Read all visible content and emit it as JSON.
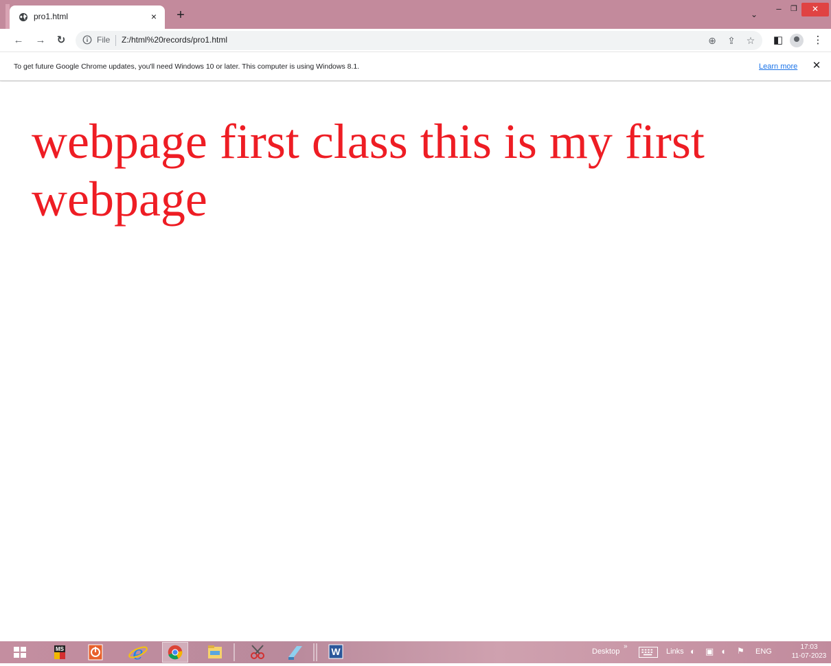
{
  "browser": {
    "tab_title": "pro1.html",
    "new_tab_label": "+",
    "tab_close_label": "×"
  },
  "toolbar": {
    "scheme_label": "File",
    "url": "Z:/html%20records/pro1.html"
  },
  "infobar": {
    "message": "To get future Google Chrome updates, you'll need Windows 10 or later. This computer is using Windows 8.1.",
    "learn_more": "Learn more",
    "close_label": "✕"
  },
  "page": {
    "heading": "webpage first class this is my first webpage",
    "heading_color": "#ee1d24"
  },
  "taskbar": {
    "desktop_label": "Desktop",
    "links_label": "Links",
    "language": "ENG",
    "time": "17:03",
    "date": "11-07-2023",
    "apps": [
      "start-icon",
      "ms-office-icon",
      "power-icon",
      "internet-explorer-icon",
      "chrome-icon",
      "file-explorer-icon",
      "snipping-tool-icon",
      "notepad-icon",
      "word-icon"
    ]
  },
  "colors": {
    "titlebar": "#c38a9c",
    "link": "#1a73e8",
    "close_button": "#e04343"
  }
}
